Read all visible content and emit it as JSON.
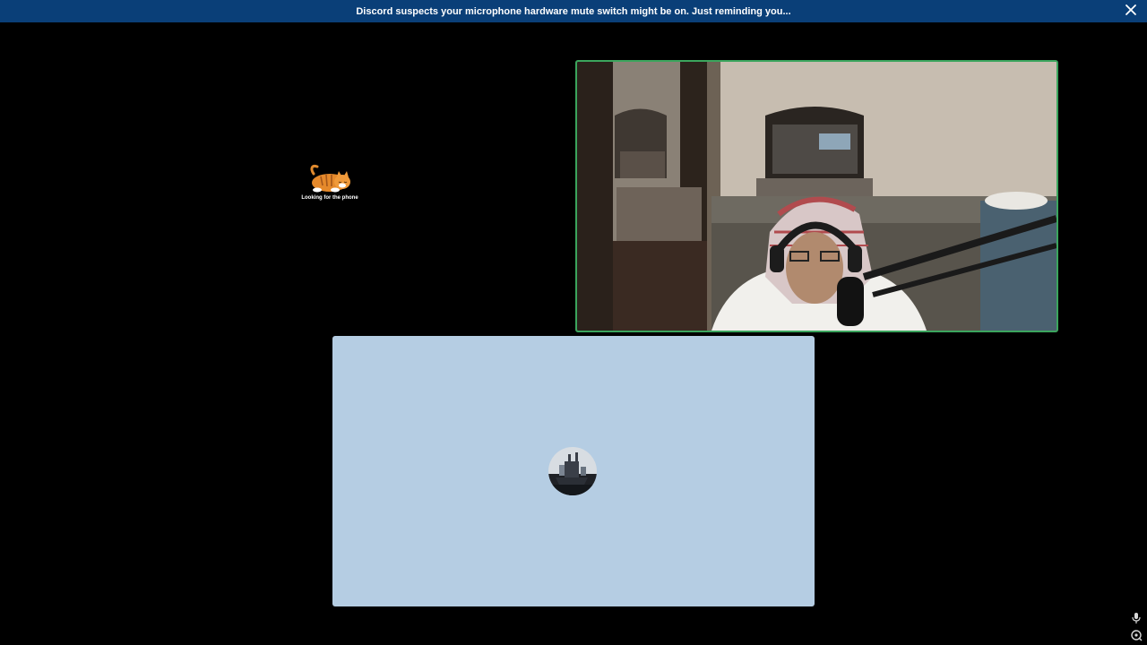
{
  "notice": {
    "message": "Discord suspects your microphone hardware mute switch might be on. Just reminding you...",
    "close_icon": "close-icon"
  },
  "tiles": {
    "avatar_tile": {
      "caption": "Looking for the phone",
      "avatar_icon": "sleeping-cat-gif"
    },
    "video_tile": {
      "speaking": true,
      "border_color": "#3ba55d"
    },
    "blue_tile": {
      "background": "#b5cde3",
      "avatar_icon": "ship-avatar"
    }
  },
  "controls": {
    "mic_icon": "microphone-icon",
    "settings_icon": "activity-icon"
  },
  "colors": {
    "banner": "#0a3f78",
    "speaking_ring": "#3ba55d"
  }
}
